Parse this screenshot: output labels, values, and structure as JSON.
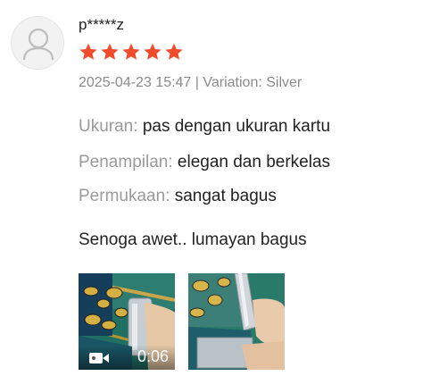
{
  "review": {
    "username": "p*****z",
    "rating": 5,
    "rating_color": "#ee4d2d",
    "meta": "2025-04-23 15:47 | Variation: Silver",
    "attributes": [
      {
        "label": "Ukuran:",
        "value": "pas dengan ukuran kartu"
      },
      {
        "label": "Penampilan:",
        "value": "elegan dan berkelas"
      },
      {
        "label": "Permukaan:",
        "value": "sangat bagus"
      }
    ],
    "comment": "Senoga awet.. lumayan bagus",
    "media": [
      {
        "type": "video",
        "duration": "0:06",
        "icon": "video-camera-icon"
      },
      {
        "type": "image"
      }
    ]
  }
}
